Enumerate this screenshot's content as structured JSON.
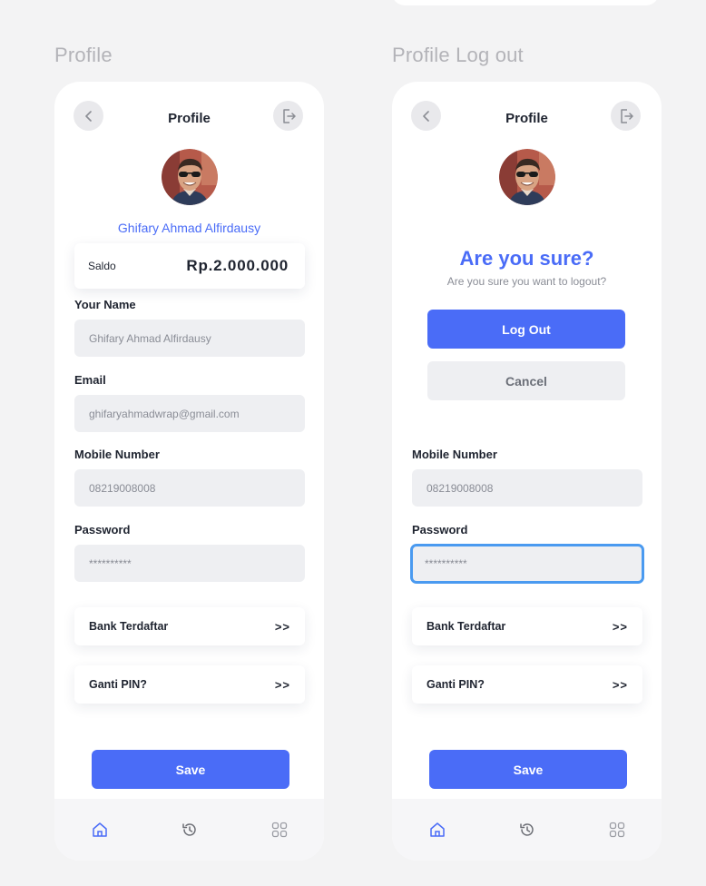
{
  "frames": {
    "profile_label": "Profile",
    "logout_label": "Profile Log out"
  },
  "header": {
    "title": "Profile",
    "back_icon": "chevron-left-icon",
    "logout_icon": "logout-door-icon"
  },
  "user": {
    "name": "Ghifary Ahmad Alfirdausy"
  },
  "saldo": {
    "label": "Saldo",
    "value": "Rp.2.000.000"
  },
  "fields": {
    "name_label": "Your Name",
    "name_value": "Ghifary Ahmad Alfirdausy",
    "email_label": "Email",
    "email_value": "ghifaryahmadwrap@gmail.com",
    "mobile_label": "Mobile Number",
    "mobile_value": "08219008008",
    "password_label": "Password",
    "password_value": "**********"
  },
  "rows": {
    "bank_label": "Bank Terdaftar",
    "pin_label": "Ganti PIN?",
    "arrow": ">>"
  },
  "actions": {
    "save_label": "Save"
  },
  "logout_dialog": {
    "title": "Are you sure?",
    "subtitle": "Are you sure you want to logout?",
    "confirm_label": "Log Out",
    "cancel_label": "Cancel"
  },
  "nav": {
    "items": [
      "home-icon",
      "history-icon",
      "grid-icon"
    ],
    "active_color": "#4a6cf7",
    "inactive_color": "#9a9ca3"
  },
  "colors": {
    "accent": "#4a6cf7",
    "focus": "#4a9af0"
  }
}
